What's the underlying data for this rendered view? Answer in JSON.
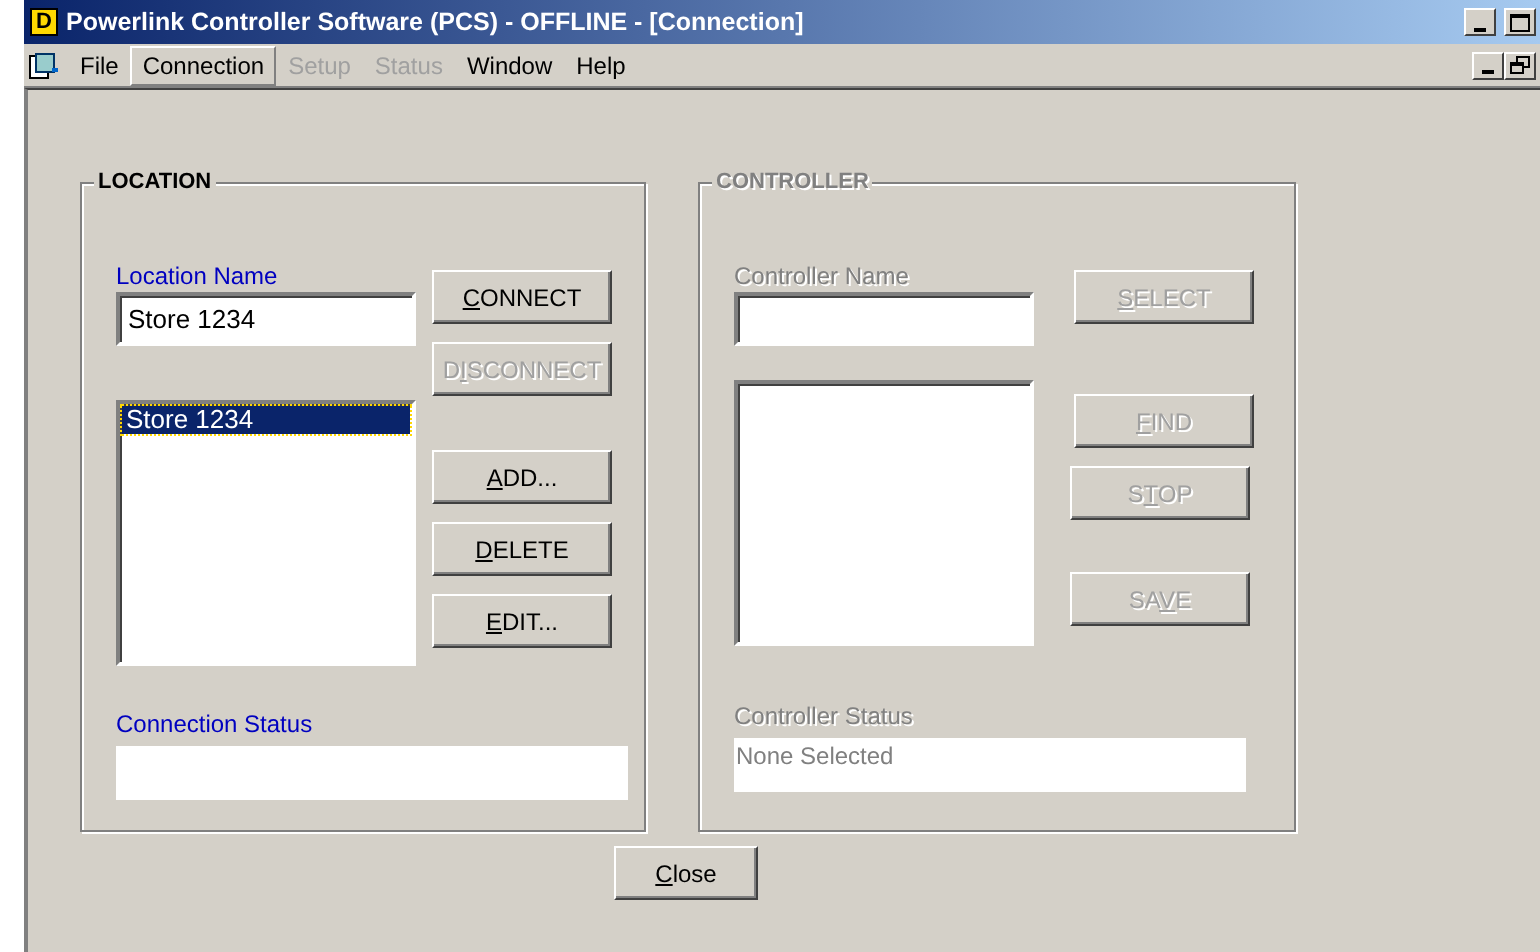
{
  "window": {
    "logo": "D",
    "title": "Powerlink Controller Software (PCS) - OFFLINE - [Connection]"
  },
  "menu": [
    {
      "label": "File",
      "disabled": false,
      "selected": false
    },
    {
      "label": "Connection",
      "disabled": false,
      "selected": true
    },
    {
      "label": "Setup",
      "disabled": true,
      "selected": false
    },
    {
      "label": "Status",
      "disabled": true,
      "selected": false
    },
    {
      "label": "Window",
      "disabled": false,
      "selected": false
    },
    {
      "label": "Help",
      "disabled": false,
      "selected": false
    }
  ],
  "groups": [
    {
      "title": "LOCATION",
      "disabled": false,
      "name_label": "Location Name",
      "name_value": "Store 1234",
      "list": [
        {
          "label": "Store 1234",
          "selected": true
        }
      ],
      "buttons": [
        {
          "key": "C",
          "after": "ONNECT",
          "disabled": false
        },
        {
          "before": "D",
          "key": "I",
          "after": "SCONNECT",
          "disabled": true
        },
        {
          "key": "A",
          "after": "DD...",
          "disabled": false
        },
        {
          "key": "D",
          "after": "ELETE",
          "disabled": false
        },
        {
          "key": "E",
          "after": "DIT...",
          "disabled": false
        }
      ],
      "status_label": "Connection Status"
    },
    {
      "title": "CONTROLLER",
      "disabled": true,
      "name_label": "Controller Name",
      "buttons": [
        {
          "key": "S",
          "after": "ELECT",
          "disabled": true
        },
        {
          "key": "F",
          "after": "IND",
          "disabled": true
        },
        {
          "before": "S",
          "key": "T",
          "after": "OP",
          "disabled": true
        },
        {
          "before": "SA",
          "key": "V",
          "after": "E",
          "disabled": true
        }
      ],
      "status_label": "Controller Status",
      "status_value": "None Selected"
    }
  ],
  "close_button": {
    "key": "C",
    "after": "lose",
    "disabled": false
  }
}
